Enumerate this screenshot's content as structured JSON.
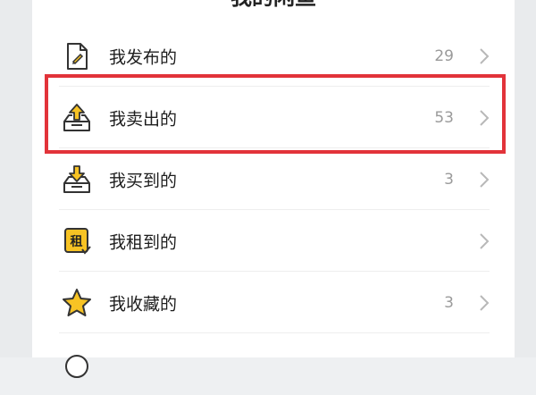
{
  "header": {
    "title": "我的闲鱼"
  },
  "menu": {
    "items": [
      {
        "label": "我发布的",
        "count": "29",
        "icon": "document-icon"
      },
      {
        "label": "我卖出的",
        "count": "53",
        "icon": "upload-box-icon"
      },
      {
        "label": "我买到的",
        "count": "3",
        "icon": "download-box-icon"
      },
      {
        "label": "我租到的",
        "count": "",
        "icon": "rent-icon",
        "icon_text": "租"
      },
      {
        "label": "我收藏的",
        "count": "3",
        "icon": "star-icon"
      },
      {
        "label": "",
        "count": "",
        "icon": "partial-icon"
      }
    ]
  },
  "colors": {
    "accent": "#f7c324",
    "highlight": "#e2333a",
    "muted": "#9a9a9a"
  }
}
